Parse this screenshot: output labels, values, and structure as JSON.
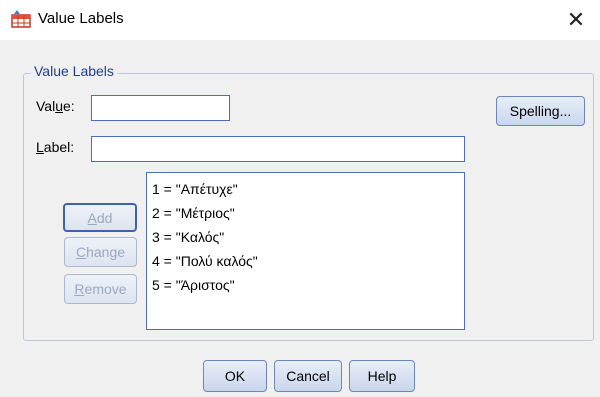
{
  "window": {
    "title": "Value Labels",
    "close_glyph": "✕"
  },
  "group": {
    "legend": "Value Labels"
  },
  "fields": {
    "value": {
      "label_pre": "Val",
      "label_access": "u",
      "label_post": "e:",
      "value": ""
    },
    "label": {
      "label_access": "L",
      "label_post": "abel:",
      "value": ""
    }
  },
  "buttons": {
    "spelling": {
      "label_pre": "Spelling..."
    },
    "add": {
      "access": "A",
      "rest": "dd"
    },
    "change": {
      "access": "C",
      "rest": "hange"
    },
    "remove": {
      "access": "R",
      "rest": "emove"
    },
    "ok": "OK",
    "cancel": "Cancel",
    "help": "Help"
  },
  "value_labels": [
    "1 = \"Απέτυχε\"",
    "2 = \"Μέτριος\"",
    "3 = \"Καλός\"",
    "4 = \"Πολύ καλός\"",
    "5 = \"Άριστος\""
  ],
  "icons": {
    "app": "spss-value-labels-icon",
    "close": "close-icon"
  }
}
